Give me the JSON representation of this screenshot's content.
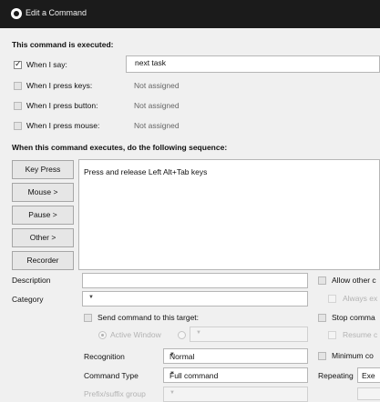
{
  "window": {
    "title": "Edit a Command"
  },
  "executed_section": {
    "heading": "This command is executed:",
    "when_i_say": {
      "label": "When I say:",
      "checked": true,
      "value": "next task"
    },
    "when_keys": {
      "label": "When I press keys:",
      "checked": false,
      "value": "Not assigned"
    },
    "when_button": {
      "label": "When I press button:",
      "checked": false,
      "value": "Not assigned"
    },
    "when_mouse": {
      "label": "When I press mouse:",
      "checked": false,
      "value": "Not assigned"
    }
  },
  "sequence_section": {
    "heading": "When this command executes, do the following sequence:",
    "buttons": {
      "key_press": "Key Press",
      "mouse": "Mouse >",
      "pause": "Pause >",
      "other": "Other >",
      "recorder": "Recorder"
    },
    "action": "Press and release Left Alt+Tab keys"
  },
  "properties": {
    "description_label": "Description",
    "description_value": "",
    "category_label": "Category",
    "category_value": "",
    "send_target_label": "Send command to this target:",
    "active_window_label": "Active Window",
    "recognition_label": "Recognition",
    "recognition_value": "Normal",
    "command_type_label": "Command Type",
    "command_type_value": "Full command",
    "prefix_label": "Prefix/suffix group"
  },
  "right_options": {
    "allow_other": "Allow other c",
    "always_ex": "Always ex",
    "stop_comma": "Stop comma",
    "resume_c": "Resume c",
    "minimum_co": "Minimum co",
    "repeating_label": "Repeating",
    "repeating_value": "Exe"
  }
}
